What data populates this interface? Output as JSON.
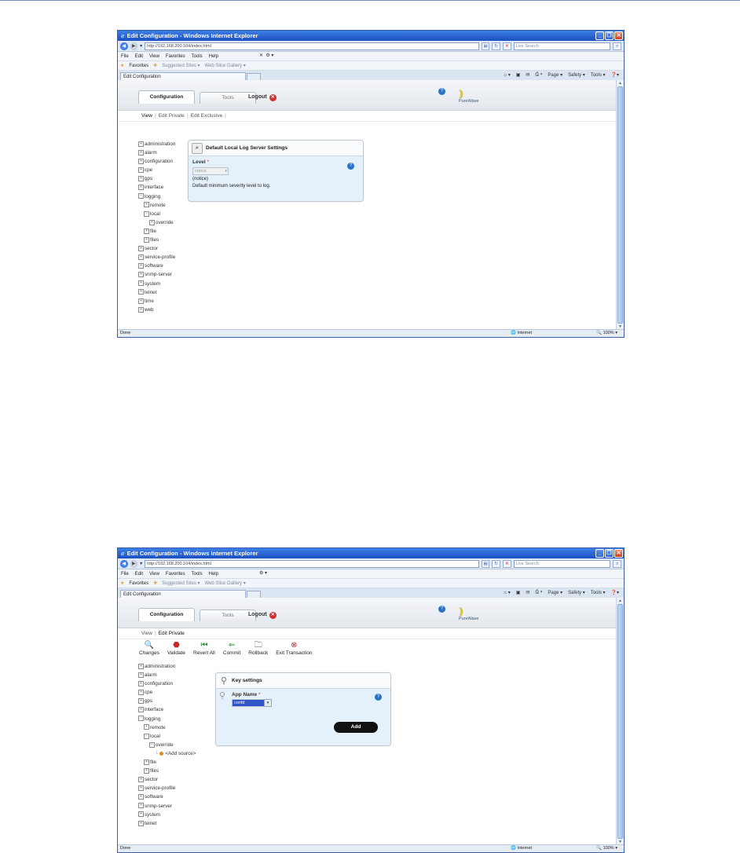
{
  "browser": {
    "window_title": "Edit Configuration - Windows Internet Explorer",
    "url": "http://192.168.200.104/index.html",
    "search_placeholder": "Live Search",
    "menu": [
      "File",
      "Edit",
      "View",
      "Favorites",
      "Tools",
      "Help"
    ],
    "favorites_label": "Favorites",
    "fav_links": [
      "Suggested Sites ▾",
      "Web Slice Gallery ▾"
    ],
    "tab_title": "Edit Configuration",
    "commands": [
      "Page ▾",
      "Safety ▾",
      "Tools ▾"
    ],
    "status_done": "Done",
    "status_zone": "Internet",
    "status_zoom": "100%"
  },
  "app": {
    "tabs": [
      "Configuration",
      "Tools"
    ],
    "logout": "Logout",
    "brand": "PureWave"
  },
  "screen1": {
    "subnav": [
      "View",
      "Edit Private",
      "Edit Exclusive"
    ],
    "tree": [
      {
        "label": "administration",
        "sign": "+",
        "level": 0
      },
      {
        "label": "alarm",
        "sign": "+",
        "level": 0
      },
      {
        "label": "configuration",
        "sign": "+",
        "level": 0
      },
      {
        "label": "cpe",
        "sign": "+",
        "level": 0
      },
      {
        "label": "gps",
        "sign": "+",
        "level": 0
      },
      {
        "label": "interface",
        "sign": "+",
        "level": 0
      },
      {
        "label": "logging",
        "sign": "−",
        "level": 0
      },
      {
        "label": "remote",
        "sign": "+",
        "level": 1
      },
      {
        "label": "local",
        "sign": "−",
        "level": 1
      },
      {
        "label": "override",
        "sign": "+",
        "level": 2
      },
      {
        "label": "file",
        "sign": "+",
        "level": 1
      },
      {
        "label": "files",
        "sign": "+",
        "level": 1
      },
      {
        "label": "sector",
        "sign": "+",
        "level": 0
      },
      {
        "label": "service-profile",
        "sign": "+",
        "level": 0
      },
      {
        "label": "software",
        "sign": "+",
        "level": 0
      },
      {
        "label": "snmp-server",
        "sign": "+",
        "level": 0
      },
      {
        "label": "system",
        "sign": "+",
        "level": 0
      },
      {
        "label": "telnet",
        "sign": "+",
        "level": 0
      },
      {
        "label": "time",
        "sign": "+",
        "level": 0
      },
      {
        "label": "web",
        "sign": "+",
        "level": 0
      }
    ],
    "panel": {
      "title": "Default Local Log Server Settings",
      "field_label": "Level",
      "required_mark": "*",
      "select_value": "notice",
      "current_value": "(notice)",
      "description": "Default minimum severity level to log."
    }
  },
  "screen2": {
    "subnav": [
      "View",
      "Edit Private"
    ],
    "toolbar": [
      {
        "label": "Changes",
        "icon": "magnifier-icon",
        "glyph": "🔍",
        "color": "#555555"
      },
      {
        "label": "Validate",
        "icon": "validate-icon",
        "glyph": "⬣",
        "color": "#c62828"
      },
      {
        "label": "Revert All",
        "icon": "revert-icon",
        "glyph": "⏮",
        "color": "#2e8b3a"
      },
      {
        "label": "Commit",
        "icon": "commit-icon",
        "glyph": "⇐",
        "color": "#2e8b3a"
      },
      {
        "label": "Rollback",
        "icon": "folder-icon",
        "glyph": "🗀",
        "color": "#4a5a6a"
      },
      {
        "label": "Exit Transaction",
        "icon": "exit-icon",
        "glyph": "⊗",
        "color": "#c62828"
      }
    ],
    "tree": [
      {
        "label": "administration",
        "sign": "+",
        "level": 0
      },
      {
        "label": "alarm",
        "sign": "+",
        "level": 0
      },
      {
        "label": "configuration",
        "sign": "+",
        "level": 0
      },
      {
        "label": "cpe",
        "sign": "+",
        "level": 0
      },
      {
        "label": "gps",
        "sign": "+",
        "level": 0
      },
      {
        "label": "interface",
        "sign": "+",
        "level": 0
      },
      {
        "label": "logging",
        "sign": "−",
        "level": 0
      },
      {
        "label": "remote",
        "sign": "+",
        "level": 1
      },
      {
        "label": "local",
        "sign": "−",
        "level": 1
      },
      {
        "label": "override",
        "sign": "−",
        "level": 2
      },
      {
        "label": "<Add source>",
        "sign": "",
        "level": 3
      },
      {
        "label": "file",
        "sign": "+",
        "level": 1
      },
      {
        "label": "files",
        "sign": "+",
        "level": 1
      },
      {
        "label": "sector",
        "sign": "+",
        "level": 0
      },
      {
        "label": "service-profile",
        "sign": "+",
        "level": 0
      },
      {
        "label": "software",
        "sign": "+",
        "level": 0
      },
      {
        "label": "snmp-server",
        "sign": "+",
        "level": 0
      },
      {
        "label": "system",
        "sign": "+",
        "level": 0
      },
      {
        "label": "telnet",
        "sign": "+",
        "level": 0
      }
    ],
    "panel": {
      "title": "Key settings",
      "field_label": "App Name",
      "required_mark": "*",
      "select_value": "confd",
      "add_button": "Add"
    }
  }
}
